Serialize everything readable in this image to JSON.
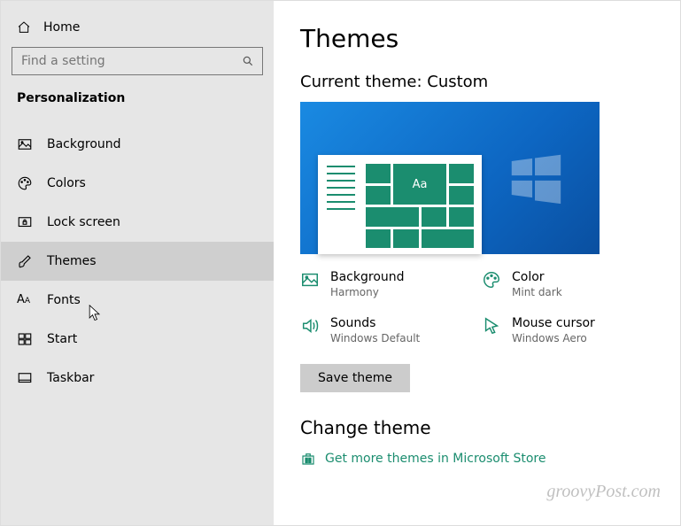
{
  "sidebar": {
    "home": "Home",
    "search_placeholder": "Find a setting",
    "category": "Personalization",
    "items": [
      {
        "id": "background",
        "label": "Background"
      },
      {
        "id": "colors",
        "label": "Colors"
      },
      {
        "id": "lockscreen",
        "label": "Lock screen"
      },
      {
        "id": "themes",
        "label": "Themes",
        "selected": true
      },
      {
        "id": "fonts",
        "label": "Fonts"
      },
      {
        "id": "start",
        "label": "Start"
      },
      {
        "id": "taskbar",
        "label": "Taskbar"
      }
    ]
  },
  "main": {
    "title": "Themes",
    "current_theme_label": "Current theme: Custom",
    "settings": {
      "background": {
        "title": "Background",
        "value": "Harmony"
      },
      "color": {
        "title": "Color",
        "value": "Mint dark"
      },
      "sounds": {
        "title": "Sounds",
        "value": "Windows Default"
      },
      "mouse": {
        "title": "Mouse cursor",
        "value": "Windows Aero"
      }
    },
    "save_button": "Save theme",
    "change_theme_heading": "Change theme",
    "store_link": "Get more themes in Microsoft Store"
  },
  "watermark": "groovyPost.com",
  "colors": {
    "accent": "#1b8d6f"
  }
}
